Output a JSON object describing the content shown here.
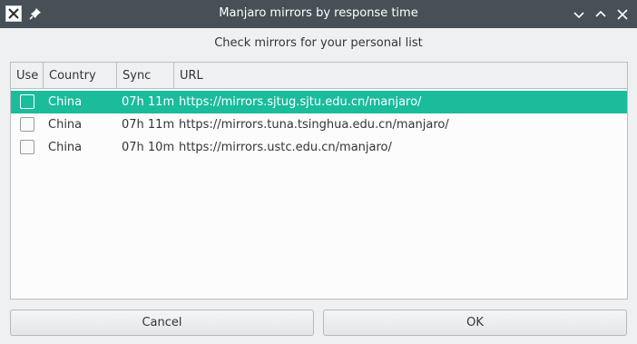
{
  "window": {
    "title": "Manjaro mirrors by response time"
  },
  "heading": "Check mirrors for your personal list",
  "table": {
    "columns": [
      "Use",
      "Country",
      "Sync",
      "URL"
    ],
    "rows": [
      {
        "checked": false,
        "selected": true,
        "country": "China",
        "sync": "07h 11m",
        "url": "https://mirrors.sjtug.sjtu.edu.cn/manjaro/"
      },
      {
        "checked": false,
        "selected": false,
        "country": "China",
        "sync": "07h 11m",
        "url": "https://mirrors.tuna.tsinghua.edu.cn/manjaro/"
      },
      {
        "checked": false,
        "selected": false,
        "country": "China",
        "sync": "07h 10m",
        "url": "https://mirrors.ustc.edu.cn/manjaro/"
      }
    ]
  },
  "buttons": {
    "cancel": "Cancel",
    "ok": "OK"
  },
  "colors": {
    "titlebar": "#475057",
    "selection": "#1abc9c",
    "window_bg": "#eff0f1"
  }
}
